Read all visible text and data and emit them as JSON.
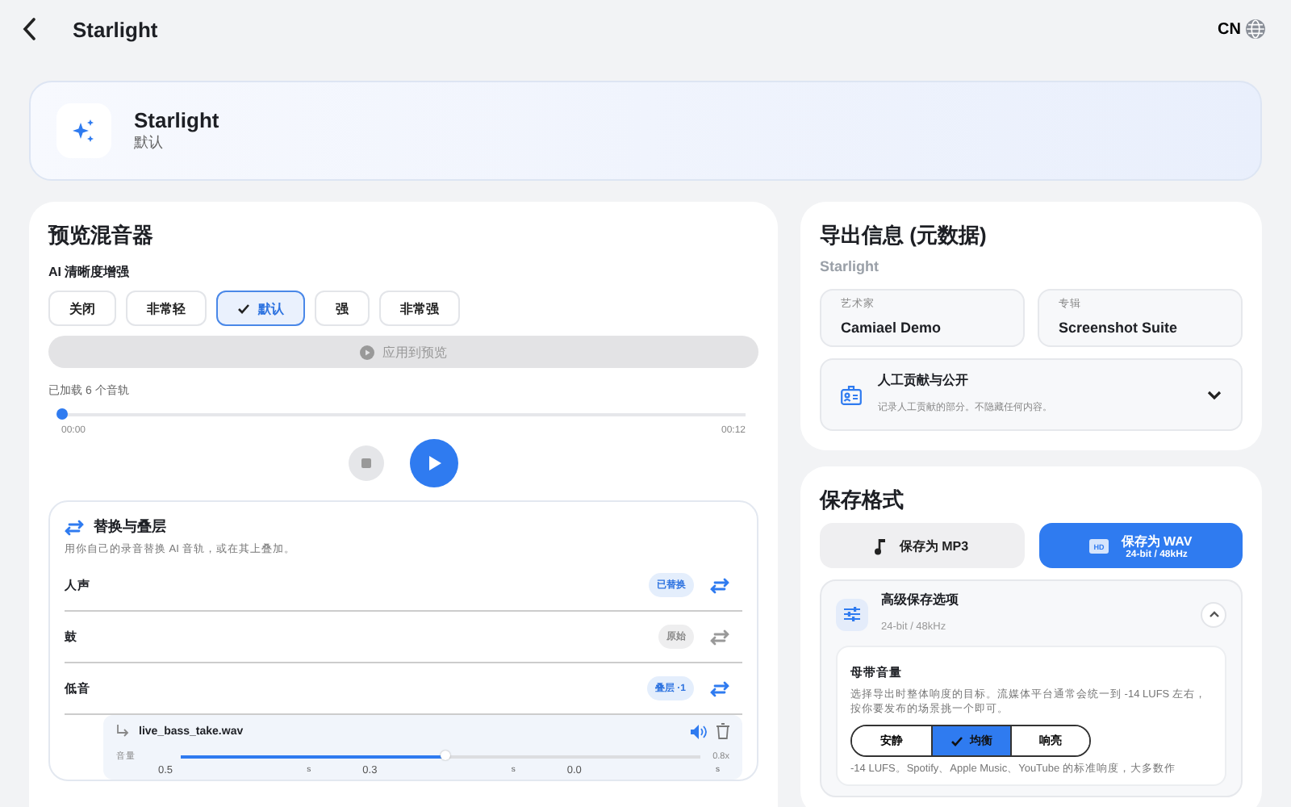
{
  "header": {
    "title": "Starlight",
    "language": "CN"
  },
  "hero": {
    "title": "Starlight",
    "subtitle": "默认"
  },
  "mixer": {
    "title": "预览混音器",
    "enhance_label": "AI 清晰度增强",
    "options": [
      {
        "label": "关闭",
        "selected": false
      },
      {
        "label": "非常轻",
        "selected": false
      },
      {
        "label": "默认",
        "selected": true
      },
      {
        "label": "强",
        "selected": false
      },
      {
        "label": "非常强",
        "selected": false
      }
    ],
    "apply_button": {
      "label": "应用到预览",
      "disabled": true
    },
    "loaded_text": "已加载 6 个音轨",
    "progress": {
      "level": 0,
      "start": "00:00",
      "end": "00:12"
    }
  },
  "replace": {
    "title": "替换与叠层",
    "description": "用你自己的录音替换 AI 音轨，或在其上叠加。",
    "tracks": [
      {
        "name": "人声",
        "badge": "已替换",
        "kind": "replaced"
      },
      {
        "name": "鼓",
        "badge": "原始",
        "kind": "original"
      },
      {
        "name": "低音",
        "badge": "叠层 ·1",
        "kind": "layer"
      }
    ],
    "layer": {
      "file": "live_bass_take.wav",
      "volume_label": "音量",
      "level": 0.51,
      "reading": "0.8x",
      "params": [
        {
          "value": "0.5",
          "unit": "s"
        },
        {
          "value": "0.3",
          "unit": "s"
        },
        {
          "value": "0.0",
          "unit": "s"
        }
      ]
    }
  },
  "export": {
    "title": "导出信息 (元数据)",
    "song": "Starlight",
    "fields": [
      {
        "label": "艺术家",
        "value": "Camiael Demo"
      },
      {
        "label": "专辑",
        "value": "Screenshot Suite"
      }
    ],
    "disclosure": {
      "title": "人工贡献与公开",
      "description": "记录人工贡献的部分。不隐藏任何内容。",
      "expanded": false
    }
  },
  "format": {
    "title": "保存格式",
    "buttons": [
      {
        "label": "保存为 MP3",
        "kind": "mp3",
        "selected": false
      },
      {
        "label": "保存为 WAV",
        "sublabel": "24-bit / 48kHz",
        "icon_text": "HD",
        "kind": "wav",
        "selected": true
      }
    ],
    "advanced": {
      "title": "高级保存选项",
      "subtitle": "24-bit / 48kHz",
      "expanded": true,
      "loudness": {
        "title": "母带音量",
        "description": "选择导出时整体响度的目标。流媒体平台通常会统一到 -14 LUFS 左右，按你要发布的场景挑一个即可。",
        "options": [
          {
            "label": "安静",
            "selected": false
          },
          {
            "label": "均衡",
            "selected": true
          },
          {
            "label": "响亮",
            "selected": false
          }
        ],
        "note": "-14 LUFS。Spotify、Apple Music、YouTube 的标准响度，大多数作"
      }
    }
  }
}
